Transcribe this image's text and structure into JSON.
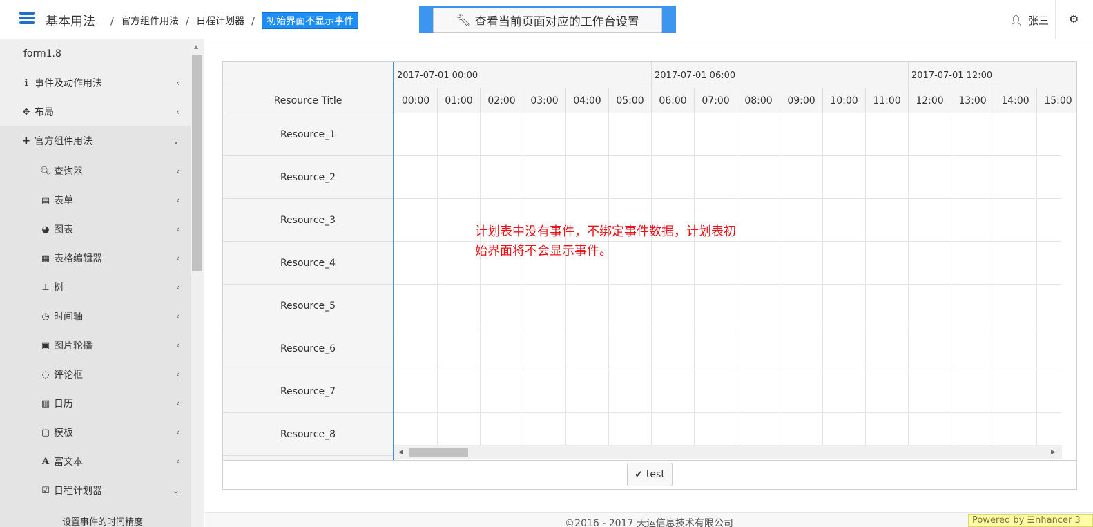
{
  "header": {
    "brand": "基本用法",
    "breadcrumb": [
      "官方组件用法",
      "日程计划器"
    ],
    "current": "初始界面不显示事件",
    "workspace_button": "查看当前页面对应的工作台设置",
    "user": "张三"
  },
  "sidebar": {
    "version": "form1.8",
    "items": [
      {
        "label": "事件及动作用法",
        "icon": "info-circle-icon",
        "glyph": "ℹ"
      },
      {
        "label": "布局",
        "icon": "move-arrows-icon",
        "glyph": "✥"
      },
      {
        "label": "官方组件用法",
        "icon": "puzzle-icon",
        "glyph": "✚"
      }
    ],
    "sub_items": [
      {
        "label": "查询器",
        "icon": "search-icon",
        "glyph": "🔍︎"
      },
      {
        "label": "表单",
        "icon": "form-icon",
        "glyph": "▤"
      },
      {
        "label": "图表",
        "icon": "pie-chart-icon",
        "glyph": "◕"
      },
      {
        "label": "表格编辑器",
        "icon": "table-icon",
        "glyph": "▦"
      },
      {
        "label": "树",
        "icon": "tree-icon",
        "glyph": "⊥"
      },
      {
        "label": "时间轴",
        "icon": "clock-icon",
        "glyph": "◷"
      },
      {
        "label": "图片轮播",
        "icon": "image-icon",
        "glyph": "▣"
      },
      {
        "label": "评论框",
        "icon": "comment-icon",
        "glyph": "◌"
      },
      {
        "label": "日历",
        "icon": "calendar-icon",
        "glyph": "▥"
      },
      {
        "label": "模板",
        "icon": "template-icon",
        "glyph": "▢"
      },
      {
        "label": "富文本",
        "icon": "font-icon",
        "glyph": "A"
      },
      {
        "label": "日程计划器",
        "icon": "calendar-check-icon",
        "glyph": "☑"
      },
      {
        "label": "设置事件的时间精度",
        "icon": "",
        "glyph": ""
      }
    ]
  },
  "scheduler": {
    "resource_title": "Resource Title",
    "days": [
      "2017-07-01 00:00",
      "2017-07-01 06:00",
      "2017-07-01 12:00"
    ],
    "hours": [
      "00:00",
      "01:00",
      "02:00",
      "03:00",
      "04:00",
      "05:00",
      "06:00",
      "07:00",
      "08:00",
      "09:00",
      "10:00",
      "11:00",
      "12:00",
      "13:00",
      "14:00",
      "15:00"
    ],
    "resources": [
      "Resource_1",
      "Resource_2",
      "Resource_3",
      "Resource_4",
      "Resource_5",
      "Resource_6",
      "Resource_7",
      "Resource_8"
    ]
  },
  "notice": "计划表中没有事件，不绑定事件数据，计划表初始界面将不会显示事件。",
  "test_button": "test",
  "footer": {
    "copyright": "©2016 - 2017 天运信息技术有限公司",
    "powered": "Powered by ☰nhancer 3"
  },
  "colors": {
    "accent": "#1e8ef5",
    "notice": "#e8141d"
  }
}
